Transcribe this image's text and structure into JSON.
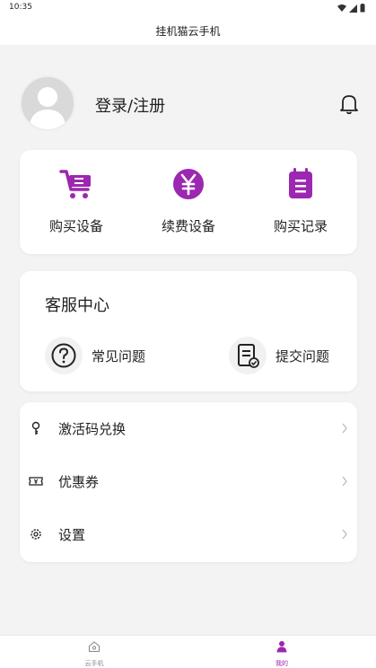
{
  "status_bar": {
    "time": "10:35"
  },
  "title_bar": {
    "title": "挂机猫云手机"
  },
  "profile": {
    "login_label": "登录/注册"
  },
  "actions": [
    {
      "label": "购买设备",
      "icon": "cart-icon"
    },
    {
      "label": "续费设备",
      "icon": "yuan-icon"
    },
    {
      "label": "购买记录",
      "icon": "clipboard-icon"
    }
  ],
  "service": {
    "title": "客服中心",
    "items": [
      {
        "label": "常见问题",
        "icon": "question-icon"
      },
      {
        "label": "提交问题",
        "icon": "submit-doc-icon"
      }
    ]
  },
  "menu": [
    {
      "label": "激活码兑换",
      "icon": "key-icon"
    },
    {
      "label": "优惠券",
      "icon": "coupon-icon"
    },
    {
      "label": "设置",
      "icon": "gear-icon"
    }
  ],
  "tabs": [
    {
      "label": "云手机",
      "icon": "home-icon",
      "active": false
    },
    {
      "label": "我的",
      "icon": "person-icon",
      "active": true
    }
  ],
  "colors": {
    "accent": "#9c27b0",
    "background": "#f3f3f3",
    "card": "#ffffff"
  }
}
